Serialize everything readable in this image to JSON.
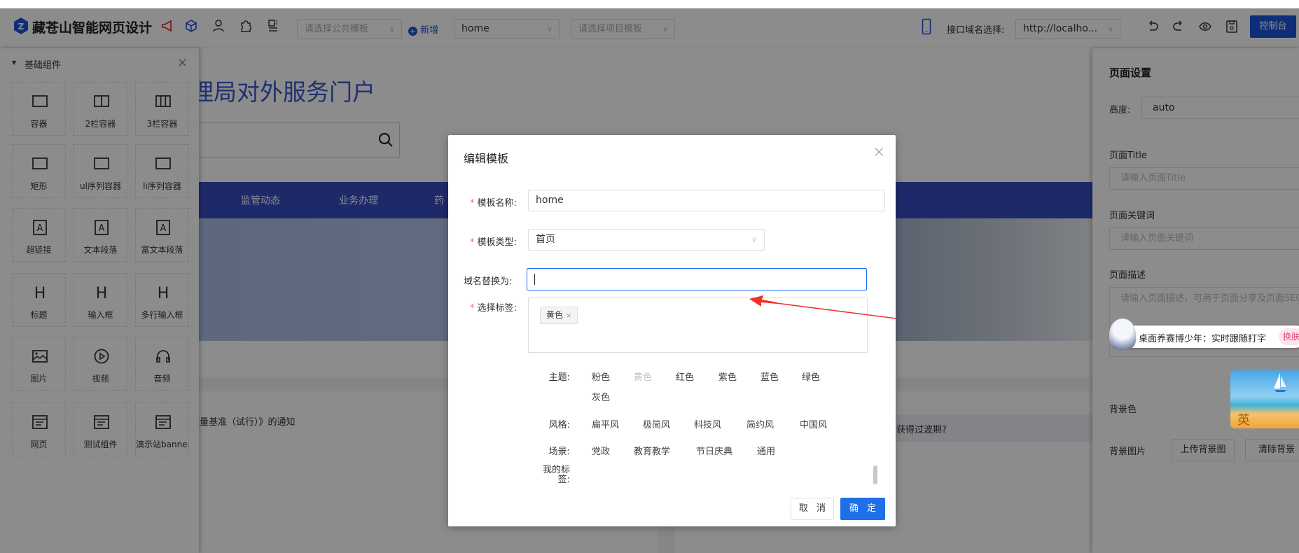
{
  "toolbar": {
    "app_name": "藏苍山智能网页设计",
    "public_template_placeholder": "请选择公共模板",
    "add_label": "新增",
    "page_select_value": "home",
    "project_template_placeholder": "请选择项目模板",
    "domain_label": "接口域名选择:",
    "domain_value": "http://localho...",
    "console_label": "控制台",
    "accent": "#1a56db"
  },
  "left_panel": {
    "title": "基础组件",
    "components": [
      {
        "label": "容器",
        "icon": "box"
      },
      {
        "label": "2栏容器",
        "icon": "col2"
      },
      {
        "label": "3栏容器",
        "icon": "col3"
      },
      {
        "label": "矩形",
        "icon": "box"
      },
      {
        "label": "ul序列容器",
        "icon": "box"
      },
      {
        "label": "li序列容器",
        "icon": "box"
      },
      {
        "label": "超链接",
        "icon": "text"
      },
      {
        "label": "文本段落",
        "icon": "text"
      },
      {
        "label": "富文本段落",
        "icon": "text"
      },
      {
        "label": "标题",
        "icon": "heading"
      },
      {
        "label": "输入框",
        "icon": "heading"
      },
      {
        "label": "多行输入框",
        "icon": "heading"
      },
      {
        "label": "图片",
        "icon": "image"
      },
      {
        "label": "视频",
        "icon": "play"
      },
      {
        "label": "音频",
        "icon": "headphones"
      },
      {
        "label": "网页",
        "icon": "webpage"
      },
      {
        "label": "测试组件",
        "icon": "webpage"
      },
      {
        "label": "演示站banner",
        "icon": "webpage"
      }
    ]
  },
  "canvas": {
    "site_title": "理局对外服务门户",
    "nav": [
      "监管动态",
      "业务办理",
      "药"
    ],
    "notice": "裁量基准（试行）》的通知",
    "faq": "获得过波期?"
  },
  "right_panel": {
    "title": "页面设置",
    "height_label": "高度:",
    "height_value": "auto",
    "title_label": "页面Title",
    "title_placeholder": "请输入页面Title",
    "keywords_label": "页面关键词",
    "keywords_placeholder": "请输入页面关键词",
    "desc_label": "页面描述",
    "desc_placeholder": "请输入页面描述，可用于页面分享及页面SEO",
    "bg_color_label": "背景色",
    "bg_image_label": "背景图片",
    "upload_bg_label": "上传背景图",
    "clear_bg_label": "清除背景"
  },
  "widget": {
    "text": "桌面养赛博少年：实时跟随打字",
    "skin_label": "换肤",
    "ime_label": "英"
  },
  "dialog": {
    "title": "编辑模板",
    "name_label": "模板名称:",
    "name_value": "home",
    "type_label": "模板类型:",
    "type_value": "首页",
    "domain_label": "域名替换为:",
    "domain_value": "",
    "tags_label": "选择标签:",
    "selected_tags": [
      "黄色"
    ],
    "groups": [
      {
        "label": "主题:",
        "options": [
          "粉色",
          "黄色",
          "红色",
          "紫色",
          "蓝色",
          "绿色",
          "灰色"
        ]
      },
      {
        "label": "风格:",
        "options": [
          "扁平风",
          "极简风",
          "科技风",
          "简约风",
          "中国风"
        ]
      },
      {
        "label": "场景:",
        "options": [
          "党政",
          "教育教学",
          "节日庆典",
          "通用"
        ]
      },
      {
        "label": "我的标签:",
        "options": []
      }
    ],
    "disabled_option": "黄色",
    "cancel_label": "取 消",
    "confirm_label": "确 定",
    "primary_color": "#1e6fe8"
  }
}
